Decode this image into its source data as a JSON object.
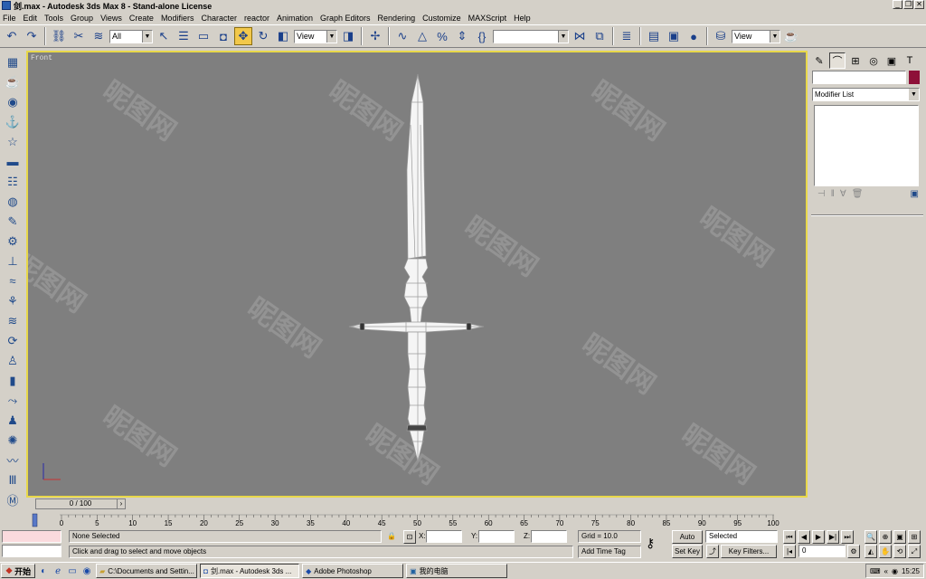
{
  "window": {
    "title": "剑.max - Autodesk 3ds Max 8  -  Stand-alone License",
    "buttons": [
      "_",
      "❐",
      "✕"
    ]
  },
  "menu": [
    "File",
    "Edit",
    "Tools",
    "Group",
    "Views",
    "Create",
    "Modifiers",
    "Character",
    "reactor",
    "Animation",
    "Graph Editors",
    "Rendering",
    "Customize",
    "MAXScript",
    "Help"
  ],
  "toolbar": {
    "selection_filter": "All",
    "ref_coord": "View",
    "named_sel": "",
    "render_view": "View"
  },
  "viewport": {
    "label": "Front",
    "watermark": "昵图网"
  },
  "command_panel": {
    "modifier_list": "Modifier List"
  },
  "timeline": {
    "slider_label": "0 / 100",
    "ticks": [
      "0",
      "5",
      "10",
      "15",
      "20",
      "25",
      "30",
      "35",
      "40",
      "45",
      "50",
      "55",
      "60",
      "65",
      "70",
      "75",
      "80",
      "85",
      "90",
      "95",
      "100"
    ]
  },
  "status": {
    "selection": "None Selected",
    "prompt": "Click and drag to select and move objects",
    "x_label": "X:",
    "y_label": "Y:",
    "z_label": "Z:",
    "grid": "Grid = 10.0",
    "add_time_tag": "Add Time Tag",
    "auto_key": "Auto Key",
    "set_key": "Set Key",
    "key_mode": "Selected",
    "key_filters": "Key Filters...",
    "frame": "0"
  },
  "taskbar": {
    "start": "开始",
    "items": [
      "C:\\Documents and Settin...",
      "剑.max - Autodesk 3ds ...",
      "Adobe Photoshop",
      "我的电脑"
    ],
    "clock": "15:25"
  }
}
